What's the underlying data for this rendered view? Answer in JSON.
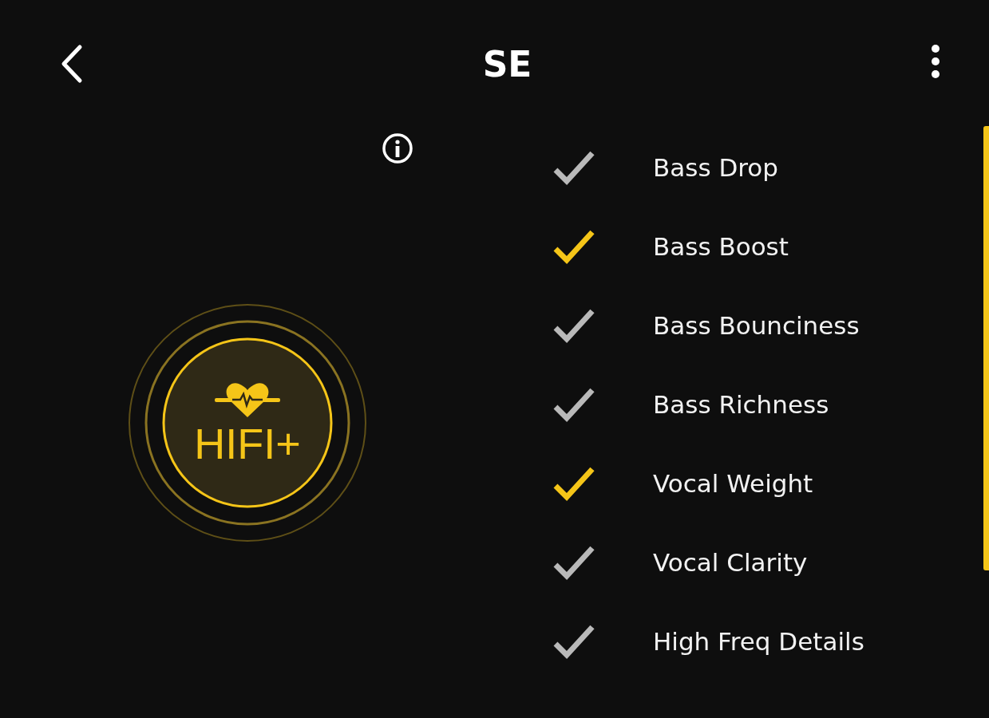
{
  "header": {
    "title": "SE"
  },
  "badge": {
    "text": "HIFI+"
  },
  "effects": [
    {
      "label": "Bass Drop",
      "checked": false
    },
    {
      "label": "Bass Boost",
      "checked": true
    },
    {
      "label": "Bass Bounciness",
      "checked": false
    },
    {
      "label": "Bass Richness",
      "checked": false
    },
    {
      "label": "Vocal Weight",
      "checked": true
    },
    {
      "label": "Vocal Clarity",
      "checked": false
    },
    {
      "label": "High Freq Details",
      "checked": false
    }
  ]
}
